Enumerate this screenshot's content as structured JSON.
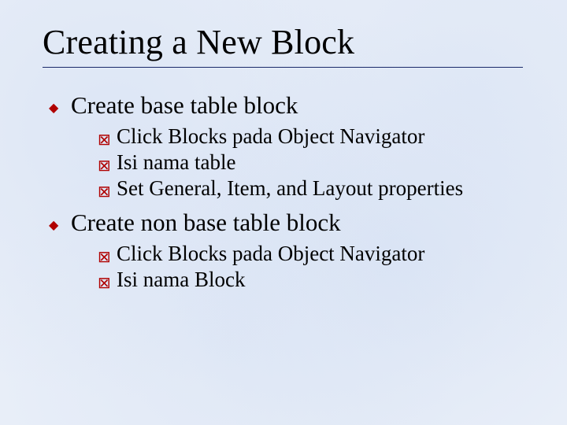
{
  "title": "Creating a New Block",
  "bullets": {
    "b1": {
      "label": "Create base table block",
      "sub": {
        "s1": "Click Blocks pada Object Navigator",
        "s2": "Isi nama table",
        "s3": "Set General, Item, and Layout properties"
      }
    },
    "b2": {
      "label": "Create non base table block",
      "sub": {
        "s1": "Click Blocks pada Object Navigator",
        "s2": "Isi nama Block"
      }
    }
  },
  "glyphs": {
    "l1": "◆",
    "l2": "⊠"
  }
}
